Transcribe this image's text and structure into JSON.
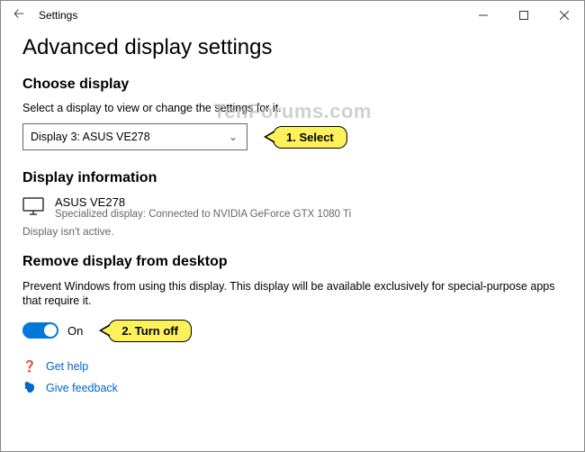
{
  "window": {
    "title": "Settings"
  },
  "page": {
    "heading": "Advanced display settings",
    "choose_display": {
      "heading": "Choose display",
      "instruction": "Select a display to view or change the settings for it.",
      "selected": "Display 3: ASUS VE278"
    },
    "display_info": {
      "heading": "Display information",
      "name": "ASUS VE278",
      "detail": "Specialized display: Connected to NVIDIA GeForce GTX 1080 Ti",
      "inactive": "Display isn't active."
    },
    "remove": {
      "heading": "Remove display from desktop",
      "description": "Prevent Windows from using this display. This display will be available exclusively for special-purpose apps that require it.",
      "toggle_label": "On"
    },
    "help": {
      "get_help": "Get help",
      "give_feedback": "Give feedback"
    }
  },
  "annotations": {
    "step1": "1. Select",
    "step2": "2. Turn off"
  },
  "watermark": "TenForums.com"
}
